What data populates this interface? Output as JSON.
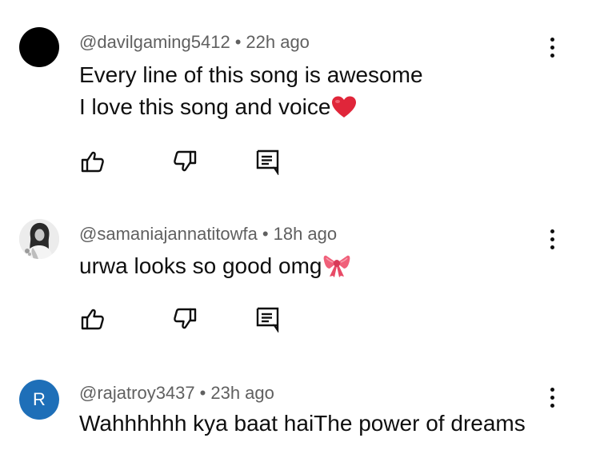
{
  "comments": [
    {
      "handle": "@davilgaming5412",
      "separator": "•",
      "time": "22h ago",
      "lines": [
        "Every line of this song is awesome",
        "I love this song and voice"
      ],
      "emoji": "heart-emoji",
      "avatar": {
        "type": "solid",
        "color": "#000000"
      }
    },
    {
      "handle": "@samaniajannatitowfa",
      "separator": "•",
      "time": "18h ago",
      "lines": [
        "urwa looks so good omg"
      ],
      "emoji": "ribbon-emoji",
      "avatar": {
        "type": "photo"
      }
    },
    {
      "handle": "@rajatroy3437",
      "separator": "•",
      "time": "23h ago",
      "lines": [
        "Wahhhhhh kya baat haiThe power of dreams"
      ],
      "avatar": {
        "type": "letter",
        "letter": "R",
        "color": "#1e6fb8"
      }
    }
  ],
  "actions": [
    "like-icon",
    "dislike-icon",
    "reply-icon"
  ],
  "colors": {
    "text": "#0f0f0f",
    "meta": "#606060",
    "heart": "#e0263a",
    "ribbon": "#f0607a",
    "letter_avatar": "#1e6fb8"
  }
}
